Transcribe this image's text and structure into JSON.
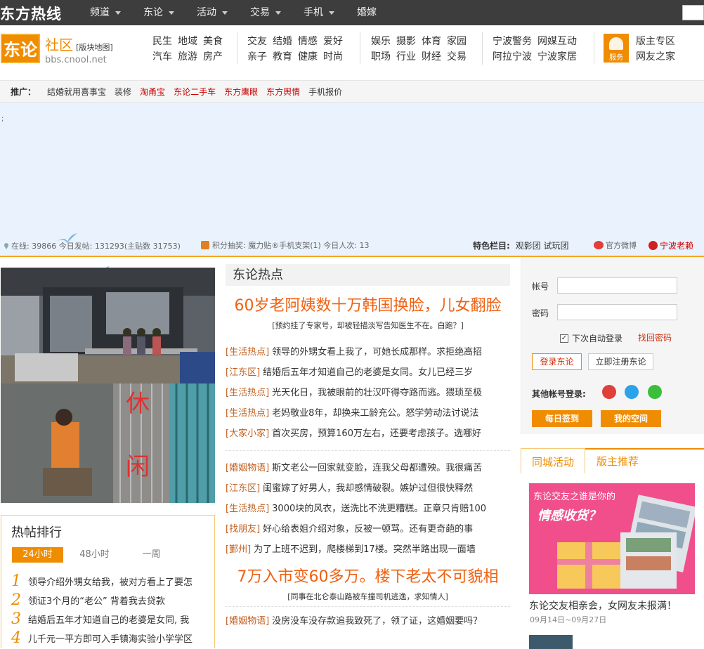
{
  "topbar": {
    "logo": "东方热线",
    "nav": [
      {
        "label": "频道",
        "dropdown": true
      },
      {
        "label": "东论",
        "dropdown": true
      },
      {
        "label": "活动",
        "dropdown": true
      },
      {
        "label": "交易",
        "dropdown": true
      },
      {
        "label": "手机",
        "dropdown": true
      },
      {
        "label": "婚嫁",
        "dropdown": false
      }
    ]
  },
  "header": {
    "logo_text": "东论",
    "site_name": "社区",
    "site_map": "[版块地图]",
    "site_url": "bbs.cnool.net",
    "groups": [
      {
        "row1": [
          "民生",
          "地域",
          "美食"
        ],
        "row2": [
          "汽车",
          "旅游",
          "房产"
        ]
      },
      {
        "row1": [
          "交友",
          "结婚",
          "情感",
          "爱好"
        ],
        "row2": [
          "亲子",
          "教育",
          "健康",
          "时尚"
        ]
      },
      {
        "row1": [
          "娱乐",
          "摄影",
          "体育",
          "家园"
        ],
        "row2": [
          "职场",
          "行业",
          "财经",
          "交易"
        ]
      },
      {
        "row1": [
          "宁波警务",
          "网媒互动"
        ],
        "row2": [
          "阿拉宁波",
          "宁波家居"
        ]
      },
      {
        "row1": [
          "版主专区"
        ],
        "row2": [
          "网友之家"
        ]
      }
    ],
    "service_label": "服务"
  },
  "promo": {
    "title": "推广：",
    "links": [
      {
        "text": "结婚就用喜事宝",
        "color": "#333333"
      },
      {
        "text": "装修",
        "color": "#333333"
      },
      {
        "text": "淘甬宝",
        "color": "#cc0000"
      },
      {
        "text": "东论二手车",
        "color": "#cc0000"
      },
      {
        "text": "东方鹰眼",
        "color": "#cc0000"
      },
      {
        "text": "东方舆情",
        "color": "#cc0000"
      },
      {
        "text": "手机报价",
        "color": "#333333"
      }
    ]
  },
  "banner": {
    "semicolon": ";"
  },
  "stats": {
    "online": "在线: 39866 今日发帖: 131293(主贴数 31753)",
    "lottery": "积分抽奖: 魔力贴®手机支架(1) 今日人次: 13",
    "featured_label": "特色栏目:",
    "featured": [
      "观影团",
      "试玩团"
    ],
    "weibo": "官方微博",
    "laolai": "宁波老赖"
  },
  "hot_ranking": {
    "title": "热帖排行",
    "tabs": [
      "24小时",
      "48小时",
      "一周"
    ],
    "items": [
      {
        "num": "1",
        "text": "领导介绍外甥女给我，被对方看上了要怎"
      },
      {
        "num": "2",
        "text": "领证3个月的“老公” 背着我去贷款"
      },
      {
        "num": "3",
        "text": "结婚后五年才知道自己的老婆是女同, 我"
      },
      {
        "num": "4",
        "text": "儿千元一平方即可入手镇海实验小学学区"
      }
    ]
  },
  "center": {
    "title": "东论热点",
    "headlines": [
      {
        "title": "60岁老阿姨数十万韩国换脸，儿女翻脸",
        "sub": "[预约挂了专家号，却被轻描淡写告知医生不在。白跑？]",
        "items": [
          {
            "tag": "[生活热点]",
            "text": "领导的外甥女看上我了，可她长成那样。求拒绝高招"
          },
          {
            "tag": "[江东区]",
            "text": "结婚后五年才知道自己的老婆是女同。女儿已经三岁"
          },
          {
            "tag": "[生活热点]",
            "text": "光天化日，我被眼前的壮汉吓得夺路而逃。猥琐至极"
          },
          {
            "tag": "[生活热点]",
            "text": "老妈敬业8年，却换来工龄充公。怒学劳动法讨说法"
          },
          {
            "tag": "[大家小家]",
            "text": "首次买房，预算160万左右，还要考虑孩子。选哪好"
          }
        ]
      },
      {
        "title": "7万入市变60多万。楼下老太不可貌相",
        "sub": "[同事在北仑泰山路被车撞司机逃逸，求知情人]",
        "items": [
          {
            "tag": "[婚姻物语]",
            "text": "没房没车没存款追我致死了，领了证，这婚姻要吗？"
          }
        ]
      }
    ],
    "mid_items": [
      {
        "tag": "[婚姻物语]",
        "text": "斯文老公一回家就变脸，连我父母都遭殃。我很痛苦"
      },
      {
        "tag": "[江东区]",
        "text": "闺蜜嫁了好男人，我却感情破裂。嫉妒过但很快释然"
      },
      {
        "tag": "[生活热点]",
        "text": "3000块的风衣，送洗比不洗更糟糕。正章只肯赔100"
      },
      {
        "tag": "[找朋友]",
        "text": "好心给表姐介绍对象，反被一顿骂。还有更奇葩的事"
      },
      {
        "tag": "[鄞州]",
        "text": "为了上班不迟到，爬楼梯到17楼。突然半路出现一面墙"
      }
    ]
  },
  "login": {
    "account_label": "帐号",
    "password_label": "密码",
    "remember": "下次自动登录",
    "forgot": "找回密码",
    "login_btn": "登录东论",
    "register_btn": "立即注册东论",
    "other_label": "其他帐号登录:",
    "signin_btn": "每日签到",
    "space_btn": "我的空间"
  },
  "activity": {
    "tabs": [
      "同城活动",
      "版主推荐"
    ],
    "pic_line1": "东论交友之谁是你的",
    "pic_line2": "情感收货？",
    "caption": "东论交友相亲会，女网友未报满！",
    "date": "09月14日~09月27日"
  },
  "colors": {
    "accent": "#f08c00",
    "topbar": "#3d3d3d",
    "banner": "#eaf3fd",
    "link_red": "#cc0000"
  }
}
